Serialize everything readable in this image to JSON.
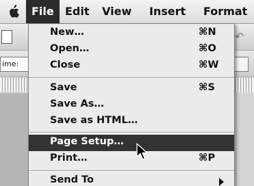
{
  "menubar": {
    "items": [
      {
        "label": "File",
        "active": true
      },
      {
        "label": "Edit"
      },
      {
        "label": "View"
      },
      {
        "label": "Insert"
      },
      {
        "label": "Format"
      }
    ]
  },
  "document": {
    "font_box_text": "ime:"
  },
  "file_menu": {
    "items": [
      {
        "label": "New…",
        "shortcut": "⌘N"
      },
      {
        "label": "Open…",
        "shortcut": "⌘O"
      },
      {
        "label": "Close",
        "shortcut": "⌘W"
      },
      {
        "label": "Save",
        "shortcut": "⌘S"
      },
      {
        "label": "Save As…",
        "shortcut": ""
      },
      {
        "label": "Save as HTML…",
        "shortcut": ""
      },
      {
        "label": "Page Setup…",
        "shortcut": "",
        "highlighted": true
      },
      {
        "label": "Print…",
        "shortcut": "⌘P"
      },
      {
        "label": "Send To",
        "shortcut": "",
        "submenu": true
      }
    ]
  },
  "colors": {
    "highlight_bg": "#333333",
    "menu_bg": "#ebebeb",
    "highlight_text": "#ffffff"
  },
  "icons": {
    "apple": "apple-icon",
    "submenu": "triangle-right-icon",
    "cursor": "arrow-cursor-icon"
  }
}
